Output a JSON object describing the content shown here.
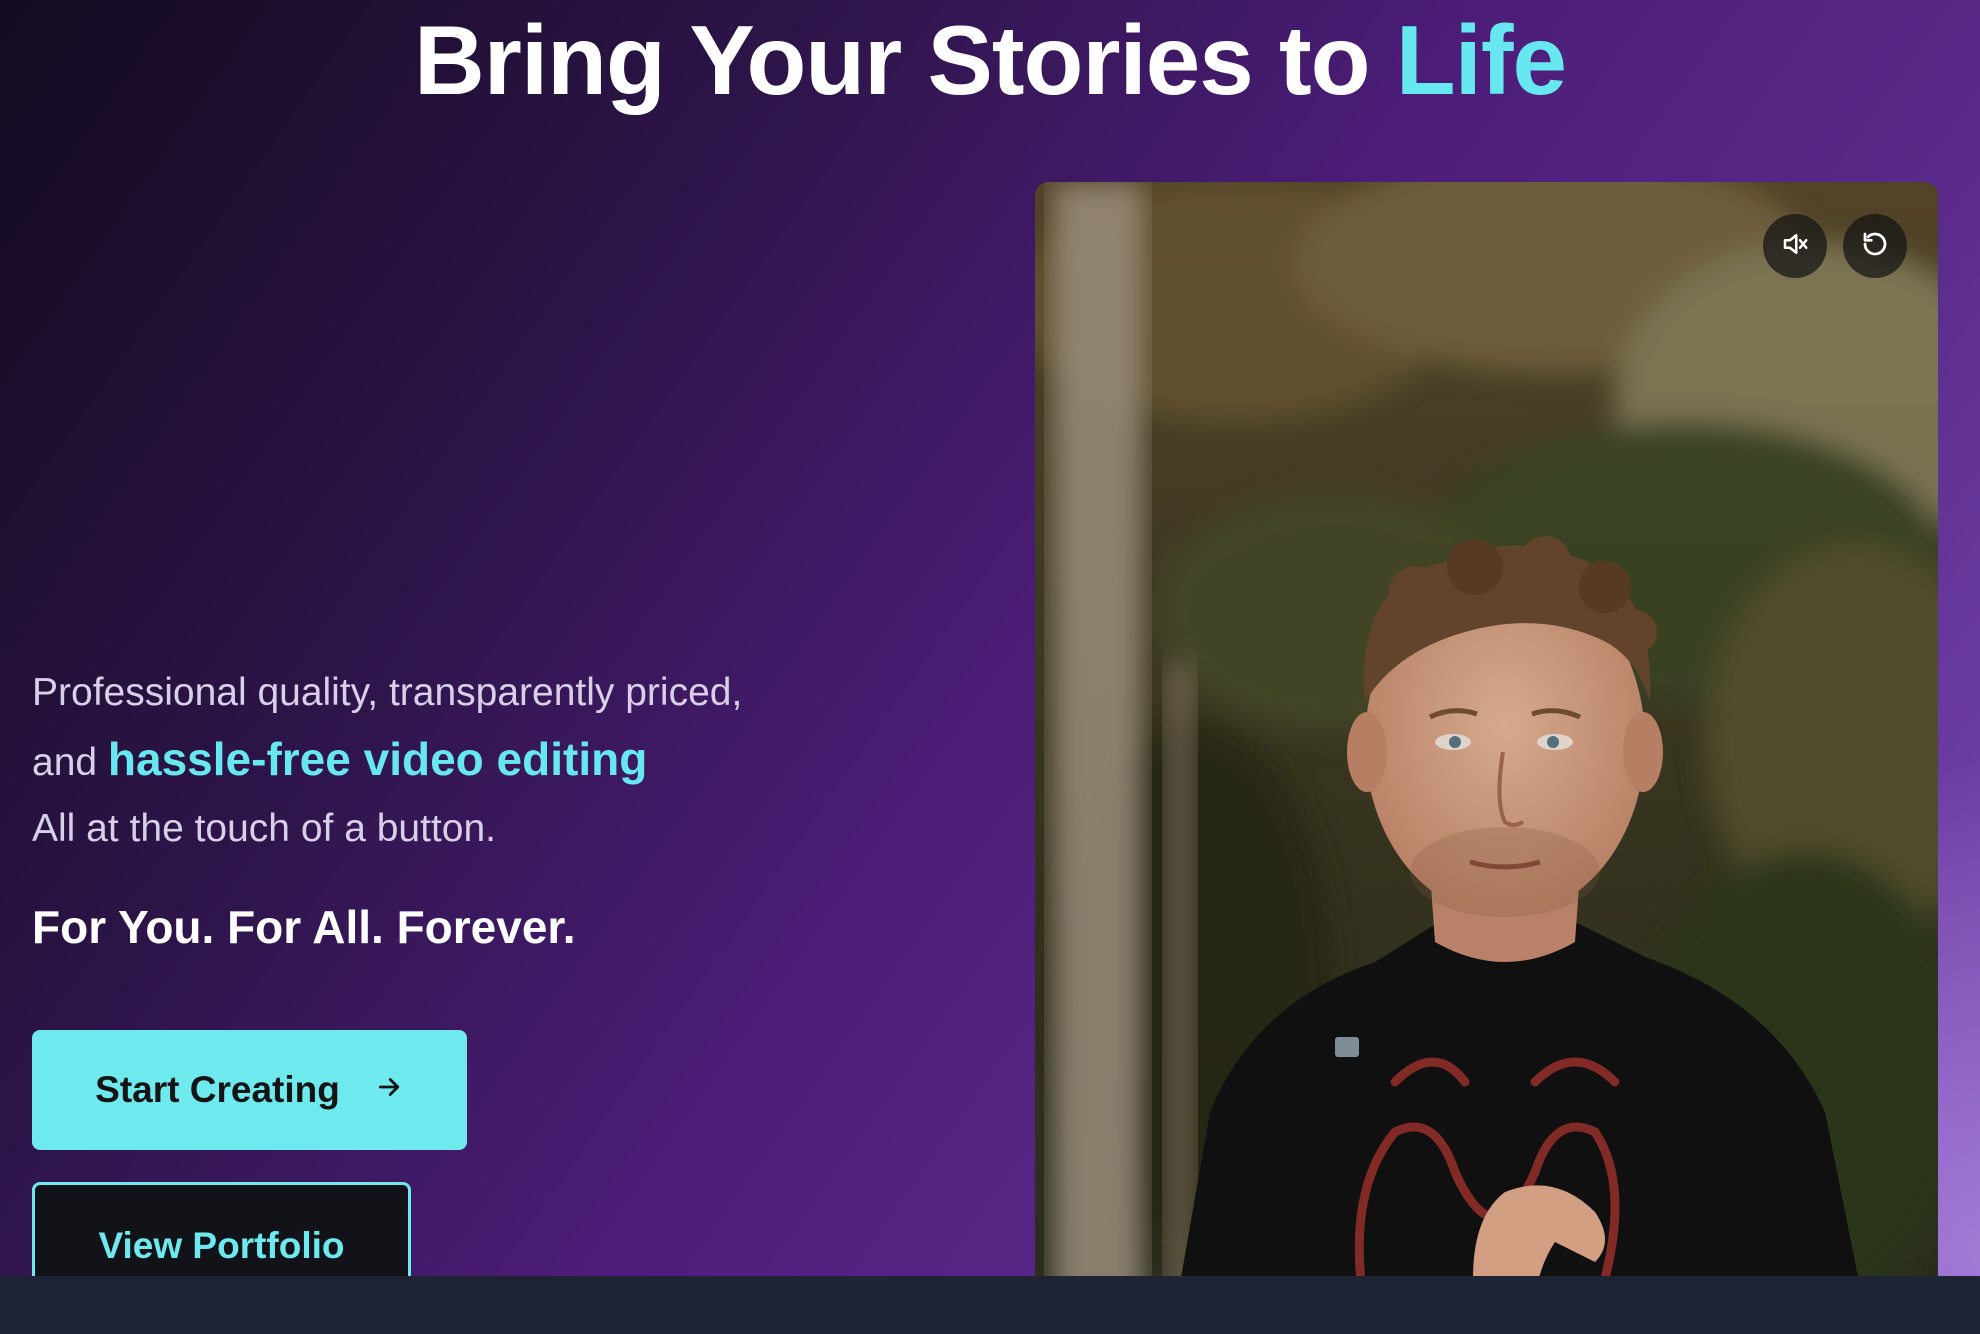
{
  "hero": {
    "title_main": "Bring Your Stories to",
    "title_accent": "Life",
    "lead_line1": "Professional quality, transparently priced,",
    "lead_and": "and",
    "lead_highlight": "hassle-free video editing",
    "lead_line3": "All at the touch of a button.",
    "tagline": "For You. For All. Forever."
  },
  "buttons": {
    "primary_label": "Start Creating",
    "primary_icon": "arrow-right-icon",
    "secondary_label": "View Portfolio"
  },
  "video": {
    "controls": [
      {
        "icon": "volume-muted-icon"
      },
      {
        "icon": "replay-icon"
      }
    ]
  },
  "colors": {
    "accent": "#67e8f0",
    "button_primary": "#6ee9ee",
    "button_secondary_bg": "#111318",
    "footer_bar": "#1e2433"
  }
}
